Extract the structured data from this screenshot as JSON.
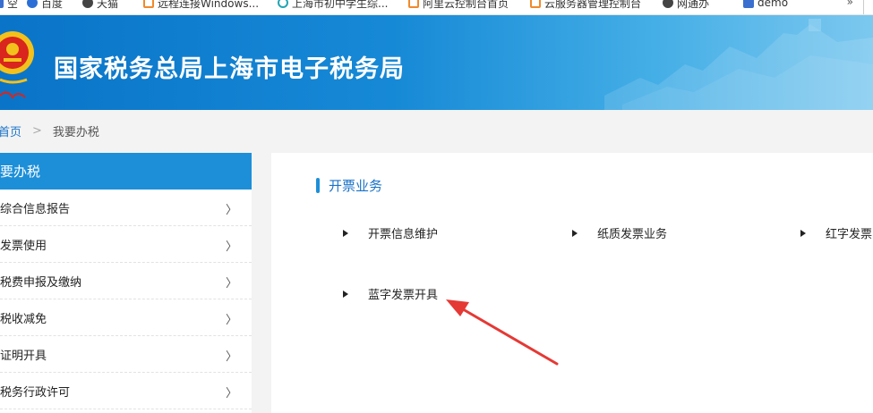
{
  "bookmarks": [
    {
      "label": "空",
      "icon": "blue-icon"
    },
    {
      "label": "百度",
      "icon": "baidu-icon"
    },
    {
      "label": "天猫",
      "icon": "tmall-icon"
    },
    {
      "label": "远程连接Windows...",
      "icon": "remote-icon"
    },
    {
      "label": "上海市初中学生综...",
      "icon": "globe-icon"
    },
    {
      "label": "阿里云控制台首页",
      "icon": "aliyun-icon"
    },
    {
      "label": "云服务器管理控制台",
      "icon": "aliyun-icon"
    },
    {
      "label": "网通办",
      "icon": "gov-icon"
    },
    {
      "label": "demo",
      "icon": "folder-icon"
    }
  ],
  "bookmarks_more": "»",
  "header": {
    "title": "国家税务总局上海市电子税务局"
  },
  "breadcrumb": {
    "home": "首页",
    "separator": ">",
    "current": "我要办税"
  },
  "sidebar": {
    "title": "要办税",
    "items": [
      {
        "label": "综合信息报告"
      },
      {
        "label": "发票使用"
      },
      {
        "label": "税费申报及缴纳"
      },
      {
        "label": "税收减免"
      },
      {
        "label": "证明开具"
      },
      {
        "label": "税务行政许可"
      }
    ],
    "chevron": "〉"
  },
  "main": {
    "section_title": "开票业务",
    "services": [
      {
        "label": "开票信息维护"
      },
      {
        "label": "纸质发票业务"
      },
      {
        "label": "红字发票"
      },
      {
        "label": "蓝字发票开具"
      }
    ]
  },
  "colors": {
    "brand_blue": "#1d8fd8",
    "link_blue": "#1a73c8",
    "annotation_red": "#e53935"
  }
}
